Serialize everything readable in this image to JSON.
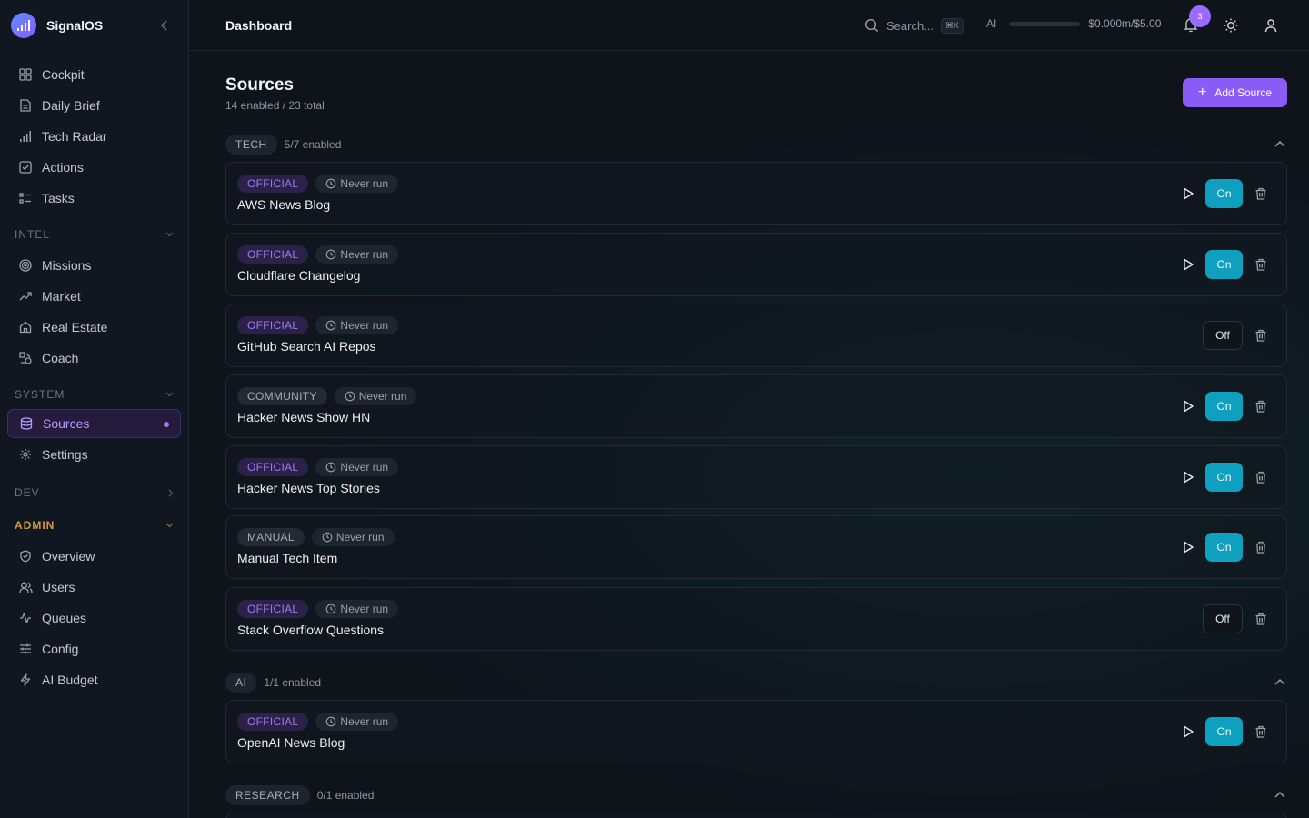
{
  "app": {
    "name": "SignalOS"
  },
  "nav": {
    "main": [
      {
        "label": "Cockpit",
        "icon": "grid-icon"
      },
      {
        "label": "Daily Brief",
        "icon": "document-icon"
      },
      {
        "label": "Tech Radar",
        "icon": "signal-bars-icon"
      },
      {
        "label": "Actions",
        "icon": "check-square-icon"
      },
      {
        "label": "Tasks",
        "icon": "list-icon"
      }
    ],
    "intel": {
      "label": "INTEL",
      "items": [
        {
          "label": "Missions",
          "icon": "target-icon"
        },
        {
          "label": "Market",
          "icon": "trend-up-icon"
        },
        {
          "label": "Real Estate",
          "icon": "home-icon"
        },
        {
          "label": "Coach",
          "icon": "shapes-icon"
        }
      ]
    },
    "system": {
      "label": "SYSTEM",
      "items": [
        {
          "label": "Sources",
          "icon": "database-icon",
          "active": true
        },
        {
          "label": "Settings",
          "icon": "gear-icon"
        }
      ]
    },
    "dev": {
      "label": "DEV"
    },
    "admin": {
      "label": "ADMIN",
      "items": [
        {
          "label": "Overview",
          "icon": "shield-icon"
        },
        {
          "label": "Users",
          "icon": "users-icon"
        },
        {
          "label": "Queues",
          "icon": "activity-icon"
        },
        {
          "label": "Config",
          "icon": "sliders-icon"
        },
        {
          "label": "AI Budget",
          "icon": "lightning-icon"
        }
      ]
    }
  },
  "topbar": {
    "title": "Dashboard",
    "search_placeholder": "Search...",
    "search_shortcut": "⌘K",
    "ai_label": "AI",
    "ai_cost": "$0.000m/$5.00",
    "ai_usage_fraction": 0,
    "notification_count": "3"
  },
  "page": {
    "title": "Sources",
    "subtitle": "14 enabled / 23 total",
    "add_button": "Add Source"
  },
  "groups": [
    {
      "tag": "TECH",
      "count": "5/7 enabled",
      "sources": [
        {
          "type": "OFFICIAL",
          "run": "Never run",
          "name": "AWS News Blog",
          "toggle": "On"
        },
        {
          "type": "OFFICIAL",
          "run": "Never run",
          "name": "Cloudflare Changelog",
          "toggle": "On"
        },
        {
          "type": "OFFICIAL",
          "run": "Never run",
          "name": "GitHub Search AI Repos",
          "toggle": "Off"
        },
        {
          "type": "COMMUNITY",
          "run": "Never run",
          "name": "Hacker News Show HN",
          "toggle": "On"
        },
        {
          "type": "OFFICIAL",
          "run": "Never run",
          "name": "Hacker News Top Stories",
          "toggle": "On"
        },
        {
          "type": "MANUAL",
          "run": "Never run",
          "name": "Manual Tech Item",
          "toggle": "On"
        },
        {
          "type": "OFFICIAL",
          "run": "Never run",
          "name": "Stack Overflow Questions",
          "toggle": "Off"
        }
      ]
    },
    {
      "tag": "AI",
      "count": "1/1 enabled",
      "sources": [
        {
          "type": "OFFICIAL",
          "run": "Never run",
          "name": "OpenAI News Blog",
          "toggle": "On"
        }
      ]
    },
    {
      "tag": "RESEARCH",
      "count": "0/1 enabled",
      "sources": []
    }
  ],
  "colors": {
    "accent": "#8a5cf6",
    "toggle_on": "#0f9fbf",
    "admin_label": "#d49a3e",
    "background": "#0f141b"
  }
}
